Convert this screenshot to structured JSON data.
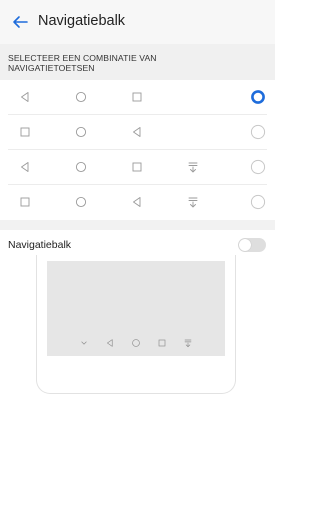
{
  "header": {
    "title": "Navigatiebalk"
  },
  "section": {
    "heading": "SELECTEER EEN COMBINATIE VAN NAVIGATIETOETSEN"
  },
  "combinations": [
    {
      "buttons": [
        "back",
        "home",
        "recents"
      ],
      "selected": true
    },
    {
      "buttons": [
        "recents",
        "home",
        "back"
      ],
      "selected": false
    },
    {
      "buttons": [
        "back",
        "home",
        "recents",
        "notifications"
      ],
      "selected": false
    },
    {
      "buttons": [
        "recents",
        "home",
        "back",
        "notifications"
      ],
      "selected": false
    }
  ],
  "toggle": {
    "label": "Navigatiebalk",
    "enabled": false
  },
  "preview": {
    "buttons": [
      "hide",
      "back",
      "home",
      "recents",
      "notifications"
    ]
  },
  "colors": {
    "accent": "#1e6cdb",
    "icon": "#9a9a9a",
    "preview_screen": "#e6e6e6"
  }
}
